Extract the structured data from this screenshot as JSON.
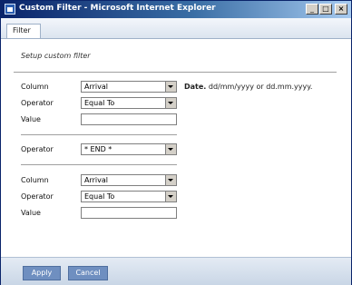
{
  "window": {
    "title": "Custom Filter - Microsoft Internet Explorer",
    "min_glyph": "_",
    "max_glyph": "□",
    "close_glyph": "×",
    "icon": "ie-page-icon"
  },
  "tabs": [
    {
      "label": "Filter"
    }
  ],
  "heading": "Setup custom filter",
  "group1": {
    "column_label": "Column",
    "column_value": "Arrival",
    "operator_label": "Operator",
    "operator_value": "Equal To",
    "value_label": "Value",
    "value": ""
  },
  "hint": {
    "bold": "Date.",
    "text": "dd/mm/yyyy or dd.mm.yyyy."
  },
  "joiner": {
    "label": "Operator",
    "value": "* END *"
  },
  "group2": {
    "column_label": "Column",
    "column_value": "Arrival",
    "operator_label": "Operator",
    "operator_value": "Equal To",
    "value_label": "Value",
    "value": ""
  },
  "buttons": {
    "apply": "Apply",
    "cancel": "Cancel"
  },
  "colors": {
    "title_bar": "#0a246a",
    "button": "#6f8fc0",
    "footer": "#d2dcea"
  }
}
